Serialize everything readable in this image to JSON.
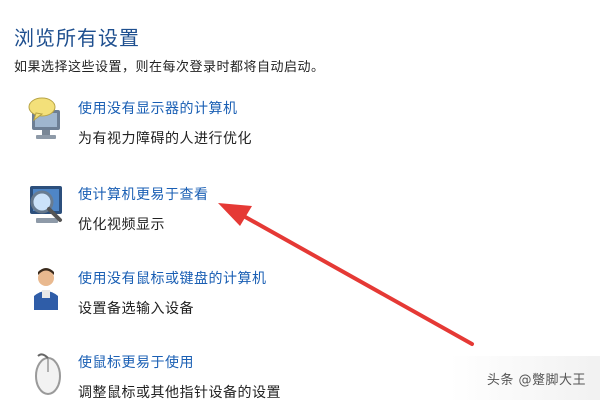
{
  "header": {
    "title": "浏览所有设置",
    "subtitle": "如果选择这些设置，则在每次登录时都将自动启动。"
  },
  "items": [
    {
      "title": "使用没有显示器的计算机",
      "desc": "为有视力障碍的人进行优化",
      "icon": "monitor-speech-icon"
    },
    {
      "title": "使计算机更易于查看",
      "desc": "优化视频显示",
      "icon": "magnifier-monitor-icon"
    },
    {
      "title": "使用没有鼠标或键盘的计算机",
      "desc": "设置备选输入设备",
      "icon": "person-icon"
    },
    {
      "title": "使鼠标更易于使用",
      "desc": "调整鼠标或其他指针设备的设置",
      "icon": "mouse-icon"
    }
  ],
  "annotation": {
    "color": "#e53935",
    "icon": "red-arrow"
  },
  "watermark": "头条 @蹩脚大王"
}
